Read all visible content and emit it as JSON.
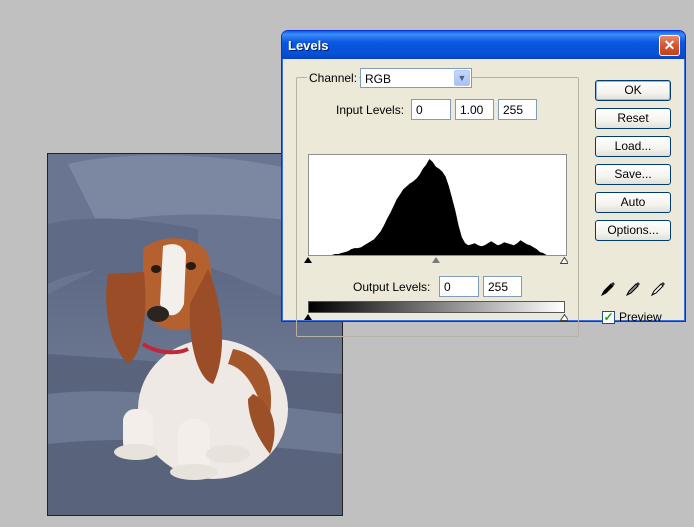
{
  "dialog": {
    "title": "Levels",
    "close_glyph": "✕",
    "channel": {
      "label": "Channel:",
      "value": "RGB"
    },
    "input_levels": {
      "label": "Input Levels:",
      "black": "0",
      "gamma": "1.00",
      "white": "255"
    },
    "output_levels": {
      "label": "Output Levels:",
      "black": "0",
      "white": "255"
    },
    "buttons": {
      "ok": "OK",
      "reset": "Reset",
      "load": "Load...",
      "save": "Save...",
      "auto": "Auto",
      "options": "Options..."
    },
    "preview": {
      "label": "Preview",
      "checked": true,
      "check_glyph": "✓"
    }
  },
  "histogram": {
    "bins": [
      0,
      0,
      0,
      0,
      0,
      0,
      0,
      0,
      1,
      1,
      2,
      3,
      4,
      6,
      7,
      7,
      8,
      10,
      12,
      14,
      16,
      20,
      24,
      30,
      37,
      43,
      50,
      57,
      62,
      67,
      70,
      73,
      75,
      78,
      82,
      88,
      92,
      98,
      95,
      90,
      88,
      85,
      80,
      70,
      58,
      45,
      30,
      18,
      12,
      10,
      11,
      12,
      10,
      9,
      10,
      12,
      14,
      12,
      10,
      11,
      13,
      12,
      11,
      10,
      12,
      15,
      13,
      11,
      10,
      8,
      6,
      3,
      2,
      0,
      0,
      0,
      0,
      0,
      0,
      0
    ],
    "max": 100
  },
  "icons": {
    "dropdown": "chevron-down-icon",
    "black_dropper": "black-eyedropper-icon",
    "gray_dropper": "gray-eyedropper-icon",
    "white_dropper": "white-eyedropper-icon"
  }
}
